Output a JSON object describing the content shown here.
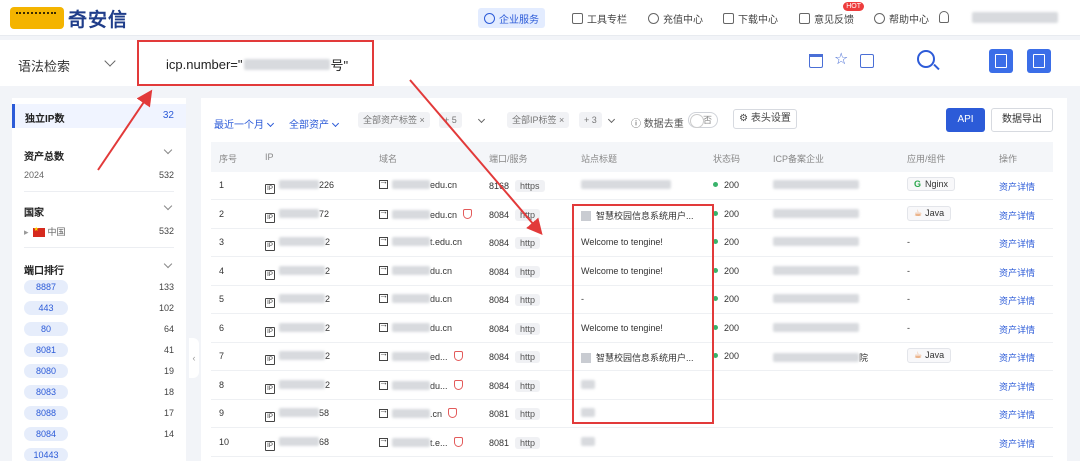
{
  "brand": {
    "name": "奇安信"
  },
  "nav": {
    "items": [
      {
        "label": "企业服务",
        "active": true
      },
      {
        "label": "工具专栏"
      },
      {
        "label": "充值中心"
      },
      {
        "label": "下载中心"
      },
      {
        "label": "意见反馈",
        "badge": "HOT"
      },
      {
        "label": "帮助中心"
      }
    ]
  },
  "search": {
    "syntax_mode": "语法检索",
    "query_prefix": "icp.number=\"",
    "query_suffix": "号\""
  },
  "sidebar": {
    "unique_ip": {
      "label": "独立IP数",
      "count": "32"
    },
    "total_assets": {
      "label": "资产总数",
      "rows": [
        {
          "label": "2024",
          "value": "532"
        }
      ]
    },
    "country": {
      "label": "国家",
      "rows": [
        {
          "label": "中国",
          "value": "532"
        }
      ]
    },
    "ports": {
      "label": "端口排行",
      "rows": [
        {
          "port": "8887",
          "count": "133"
        },
        {
          "port": "443",
          "count": "102"
        },
        {
          "port": "80",
          "count": "64"
        },
        {
          "port": "8081",
          "count": "41"
        },
        {
          "port": "8080",
          "count": "19"
        },
        {
          "port": "8083",
          "count": "18"
        },
        {
          "port": "8088",
          "count": "17"
        },
        {
          "port": "8084",
          "count": "14"
        },
        {
          "port": "10443",
          "count": ""
        }
      ]
    }
  },
  "filters": {
    "time": "最近一个月",
    "assets": "全部资产",
    "asset_tags": "全部资产标签",
    "asset_tags_more": "+ 5",
    "ip_tags": "全部IP标签",
    "ip_tags_more": "+ 3",
    "dedup_label": "数据去重",
    "dedup_state": "否",
    "header_settings": "表头设置",
    "api": "API",
    "export": "数据导出"
  },
  "table": {
    "headers": [
      "序号",
      "IP",
      "域名",
      "端口/服务",
      "站点标题",
      "状态码",
      "ICP备案企业",
      "应用/组件",
      "操作"
    ],
    "rows": [
      {
        "no": "1",
        "ip": "226",
        "domain": "edu.cn",
        "port": "8168",
        "service": "https",
        "title": "",
        "status": "200",
        "icp": "",
        "app": "Nginx",
        "app_type": "g",
        "op": "资产详情",
        "shield": false
      },
      {
        "no": "2",
        "ip": "72",
        "domain": "edu.cn",
        "port": "8084",
        "service": "http",
        "title": "智慧校园信息系统用户...",
        "status": "200",
        "icp": "",
        "app": "Java",
        "app_type": "j",
        "op": "资产详情",
        "shield": true
      },
      {
        "no": "3",
        "ip": "2",
        "domain": "t.edu.cn",
        "port": "8084",
        "service": "http",
        "title": "Welcome to tengine!",
        "status": "200",
        "icp": "",
        "app": "-",
        "app_type": "",
        "op": "资产详情",
        "shield": false
      },
      {
        "no": "4",
        "ip": "2",
        "domain": "du.cn",
        "port": "8084",
        "service": "http",
        "title": "Welcome to tengine!",
        "status": "200",
        "icp": "",
        "app": "-",
        "app_type": "",
        "op": "资产详情",
        "shield": false
      },
      {
        "no": "5",
        "ip": "2",
        "domain": "du.cn",
        "port": "8084",
        "service": "http",
        "title": "-",
        "status": "200",
        "icp": "",
        "app": "-",
        "app_type": "",
        "op": "资产详情",
        "shield": false
      },
      {
        "no": "6",
        "ip": "2",
        "domain": "du.cn",
        "port": "8084",
        "service": "http",
        "title": "Welcome to tengine!",
        "status": "200",
        "icp": "",
        "app": "-",
        "app_type": "",
        "op": "资产详情",
        "shield": false
      },
      {
        "no": "7",
        "ip": "2",
        "domain": "ed...",
        "port": "8084",
        "service": "http",
        "title": "智慧校园信息系统用户...",
        "status": "200",
        "icp": "院",
        "app": "Java",
        "app_type": "j",
        "op": "资产详情",
        "shield": true
      },
      {
        "no": "8",
        "ip": "2",
        "domain": "du...",
        "port": "8084",
        "service": "http",
        "title": "",
        "status": "",
        "icp": "",
        "app": "",
        "app_type": "",
        "op": "资产详情",
        "shield": true
      },
      {
        "no": "9",
        "ip": "58",
        "domain": ".cn",
        "port": "8081",
        "service": "http",
        "title": "",
        "status": "",
        "icp": "",
        "app": "",
        "app_type": "",
        "op": "资产详情",
        "shield": true
      },
      {
        "no": "10",
        "ip": "68",
        "domain": "t.e...",
        "port": "8081",
        "service": "http",
        "title": "",
        "status": "",
        "icp": "",
        "app": "",
        "app_type": "",
        "op": "资产详情",
        "shield": true
      }
    ]
  }
}
